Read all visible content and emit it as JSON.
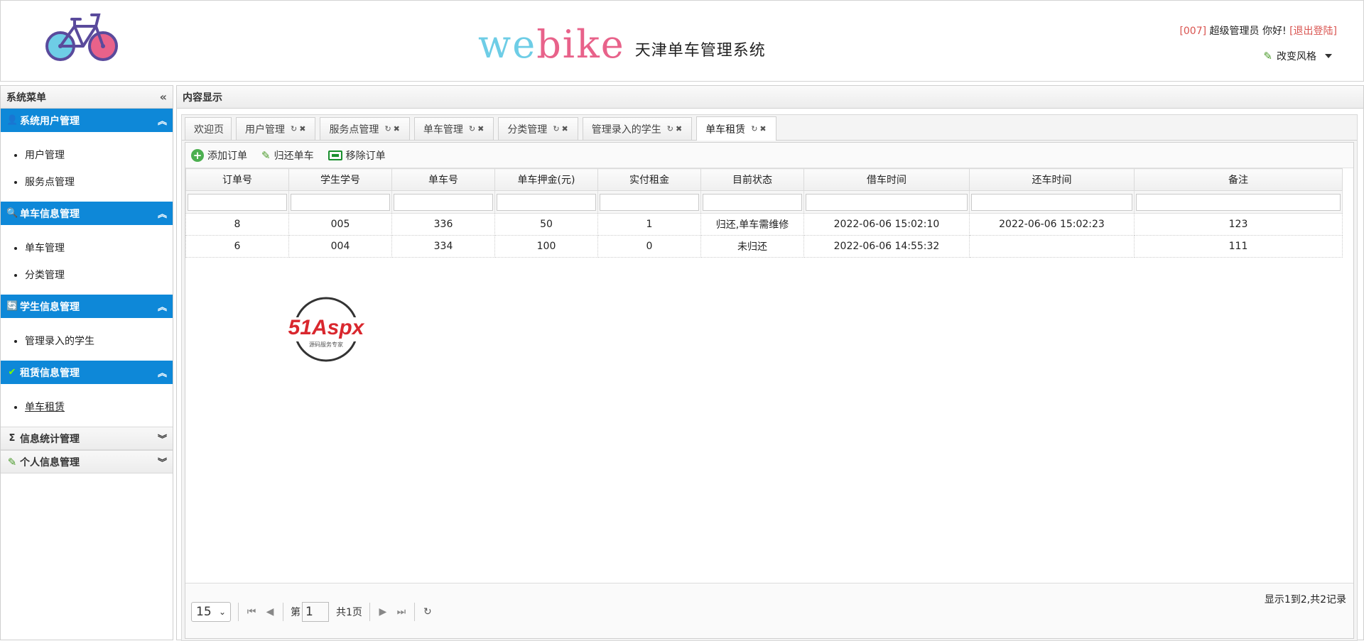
{
  "header": {
    "brand_letters": [
      "w",
      "e",
      "b",
      "i",
      "k",
      "e"
    ],
    "brand_subtitle": "天津单车管理系统",
    "user_code": "[007]",
    "user_greeting": "超级管理员 你好!",
    "logout_label": "[退出登陆]",
    "style_switch_label": "改变风格"
  },
  "sidebar": {
    "title": "系统菜单",
    "groups": [
      {
        "title": "系统用户管理",
        "icon": "user-icon",
        "expanded": true,
        "items": [
          "用户管理",
          "服务点管理"
        ]
      },
      {
        "title": "单车信息管理",
        "icon": "search-icon",
        "expanded": true,
        "items": [
          "单车管理",
          "分类管理"
        ]
      },
      {
        "title": "学生信息管理",
        "icon": "refresh-icon",
        "expanded": true,
        "items": [
          "管理录入的学生"
        ]
      },
      {
        "title": "租赁信息管理",
        "icon": "check-icon",
        "expanded": true,
        "items": [
          "单车租赁"
        ]
      },
      {
        "title": "信息统计管理",
        "icon": "sigma-icon",
        "expanded": false,
        "items": []
      },
      {
        "title": "个人信息管理",
        "icon": "pencil-icon",
        "expanded": false,
        "items": []
      }
    ]
  },
  "content": {
    "title": "内容显示",
    "tabs": [
      {
        "label": "欢迎页",
        "closable": false
      },
      {
        "label": "用户管理",
        "closable": true
      },
      {
        "label": "服务点管理",
        "closable": true
      },
      {
        "label": "单车管理",
        "closable": true
      },
      {
        "label": "分类管理",
        "closable": true
      },
      {
        "label": "管理录入的学生",
        "closable": true
      },
      {
        "label": "单车租赁",
        "closable": true,
        "selected": true
      }
    ],
    "toolbar": {
      "add_label": "添加订单",
      "return_label": "归还单车",
      "remove_label": "移除订单"
    },
    "table": {
      "columns": [
        "订单号",
        "学生学号",
        "单车号",
        "单车押金(元)",
        "实付租金",
        "目前状态",
        "借车时间",
        "还车时间",
        "备注"
      ],
      "rows": [
        [
          "8",
          "005",
          "336",
          "50",
          "1",
          "归还,单车需维修",
          "2022-06-06 15:02:10",
          "2022-06-06 15:02:23",
          "123"
        ],
        [
          "6",
          "004",
          "334",
          "100",
          "0",
          "未归还",
          "2022-06-06 14:55:32",
          "",
          "111"
        ]
      ]
    },
    "watermark": {
      "text": "51Aspx",
      "subtext": "源码服务专家"
    },
    "pager": {
      "page_size": "15",
      "page_prefix": "第",
      "page_value": "1",
      "page_total": "共1页",
      "summary": "显示1到2,共2记录"
    }
  },
  "colors": {
    "accent": "#0e88d8",
    "danger": "#e0262b"
  }
}
